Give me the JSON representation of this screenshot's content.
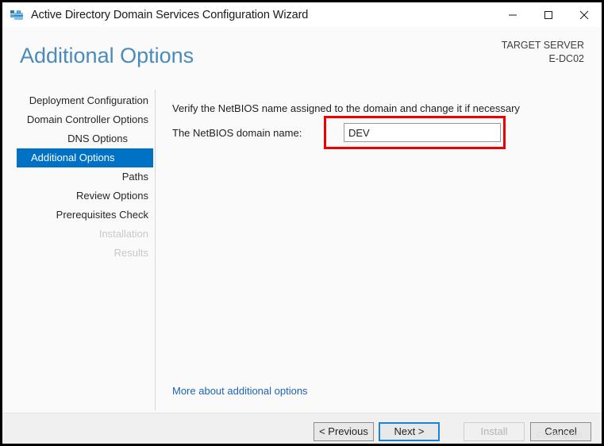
{
  "window": {
    "title": "Active Directory Domain Services Configuration Wizard",
    "app_icon": "server-manager-icon",
    "controls": {
      "minimize": "minimize-icon",
      "maximize": "maximize-icon",
      "close": "close-icon"
    }
  },
  "header": {
    "page_title": "Additional Options",
    "target_server_label": "TARGET SERVER",
    "target_server_name": "E-DC02"
  },
  "nav": {
    "items": [
      {
        "label": "Deployment Configuration",
        "state": "normal",
        "indent": false
      },
      {
        "label": "Domain Controller Options",
        "state": "normal",
        "indent": false
      },
      {
        "label": "DNS Options",
        "state": "normal",
        "indent": true
      },
      {
        "label": "Additional Options",
        "state": "selected",
        "indent": false
      },
      {
        "label": "Paths",
        "state": "normal",
        "indent": false
      },
      {
        "label": "Review Options",
        "state": "normal",
        "indent": false
      },
      {
        "label": "Prerequisites Check",
        "state": "normal",
        "indent": false
      },
      {
        "label": "Installation",
        "state": "disabled",
        "indent": false
      },
      {
        "label": "Results",
        "state": "disabled",
        "indent": false
      }
    ]
  },
  "content": {
    "instruction": "Verify the NetBIOS name assigned to the domain and change it if necessary",
    "netbios_label": "The NetBIOS domain name:",
    "netbios_value": "DEV",
    "netbios_placeholder": "",
    "more_link": "More about additional options"
  },
  "footer": {
    "buttons": [
      {
        "label": "< Previous",
        "state": "normal"
      },
      {
        "label": "Next >",
        "state": "focused"
      },
      {
        "label": "Install",
        "state": "disabled"
      },
      {
        "label": "Cancel",
        "state": "normal"
      }
    ]
  },
  "watermark": "CSDN @0pr",
  "colors": {
    "accent_blue": "#0072c6",
    "title_blue": "#4a8bbd",
    "link_blue": "#1b65b5",
    "highlight_red": "#ef0000",
    "focus_blue": "#1883d7"
  }
}
